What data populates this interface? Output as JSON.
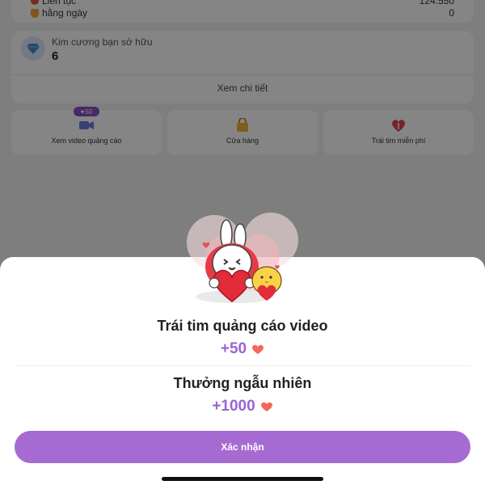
{
  "background": {
    "stats": [
      {
        "label": "Liên tục",
        "value": "124.550"
      },
      {
        "label": "hằng ngày",
        "value": "0"
      }
    ],
    "diamond": {
      "label": "Kim cương bạn sở hữu",
      "value": "6"
    },
    "detail_link": "Xem chi tiết",
    "tiles": [
      {
        "label": "Xem video quảng cáo",
        "icon": "video-camera-icon",
        "badge": "50"
      },
      {
        "label": "Cửa hàng",
        "icon": "shopping-bag-icon"
      },
      {
        "label": "Trái tim miễn phí",
        "icon": "gift-heart-icon"
      }
    ]
  },
  "sheet": {
    "title1": "Trái tim quảng cáo video",
    "reward1": "+50",
    "title2": "Thưởng ngẫu nhiên",
    "reward2": "+1000",
    "confirm_label": "Xác nhận",
    "heart_icon": "heart-icon",
    "accent_color": "#a66bd3"
  }
}
